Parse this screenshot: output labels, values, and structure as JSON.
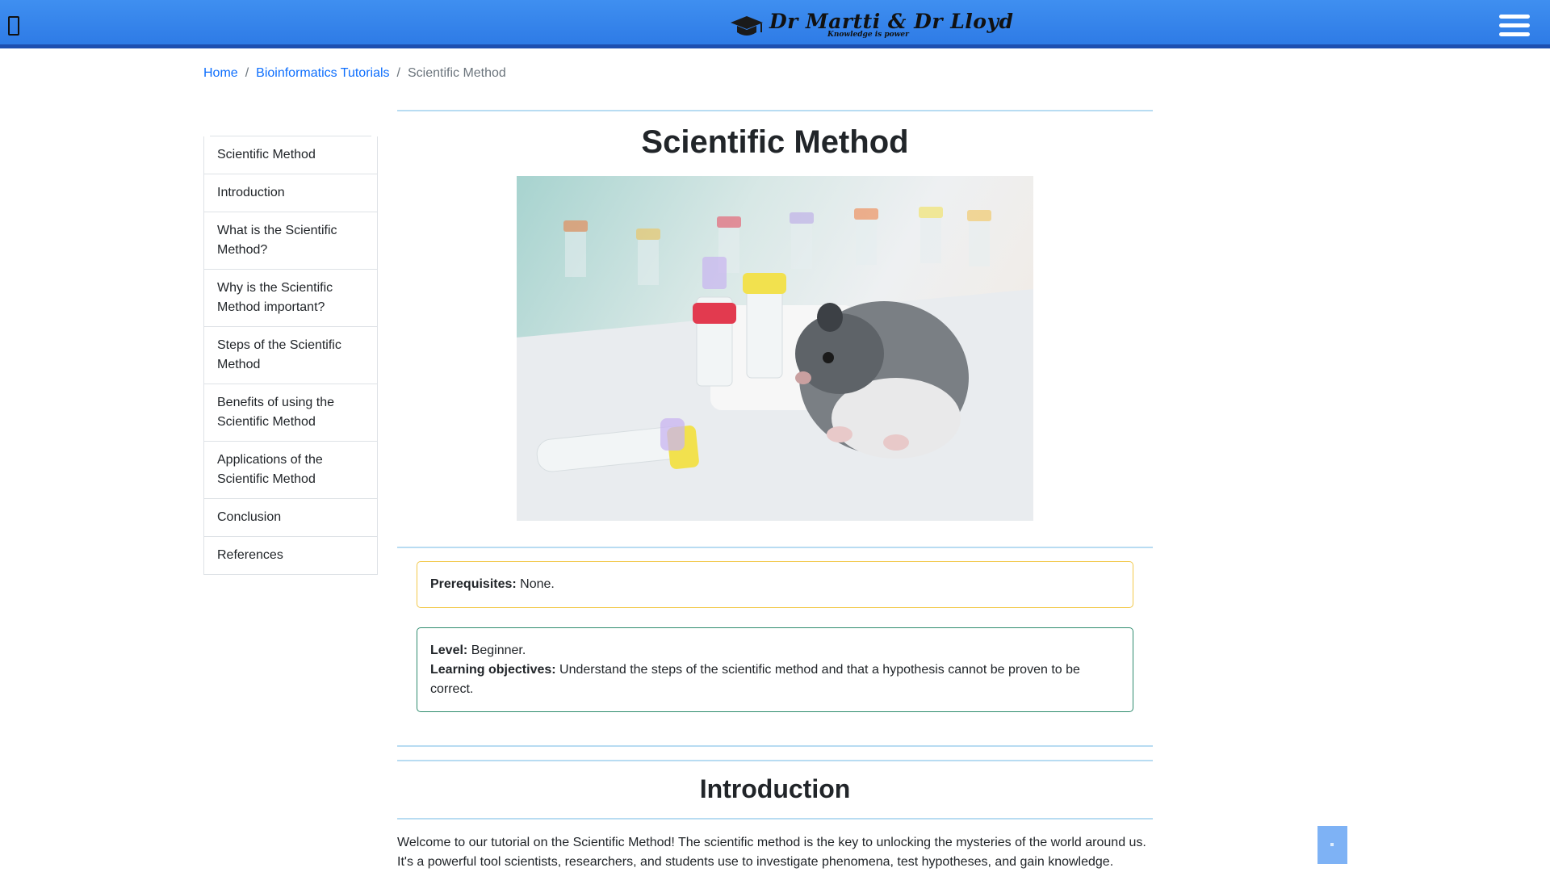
{
  "header": {
    "logo": {
      "title": "Dr Martti & Dr Lloyd",
      "tagline": "Knowledge is power"
    },
    "menu_icon": "hamburger-icon",
    "left_icon": "mobile-icon"
  },
  "breadcrumb": {
    "home": "Home",
    "section": "Bioinformatics Tutorials",
    "current": "Scientific Method",
    "separator": "/"
  },
  "sidebar": {
    "items": [
      {
        "label": "Scientific Method"
      },
      {
        "label": "Introduction"
      },
      {
        "label": "What is the Scientific Method?"
      },
      {
        "label": "Why is the Scientific Method important?"
      },
      {
        "label": "Steps of the Scientific Method"
      },
      {
        "label": "Benefits of using the Scientific Method"
      },
      {
        "label": "Applications of the Scientific Method"
      },
      {
        "label": "Conclusion"
      },
      {
        "label": "References"
      }
    ]
  },
  "main": {
    "title": "Scientific Method",
    "prerequisites": {
      "label": "Prerequisites:",
      "value": "None."
    },
    "level": {
      "label": "Level:",
      "value": "Beginner."
    },
    "objectives": {
      "label": "Learning objectives:",
      "value": "Understand the steps of the scientific method and that a hypothesis cannot be proven to be correct."
    },
    "intro_heading": "Introduction",
    "intro_text": "Welcome to our tutorial on the Scientific Method! The scientific method is the key to unlocking the mysteries of the world around us. It's a powerful tool scientists, researchers, and students use to investigate phenomena, test hypotheses, and gain knowledge."
  },
  "colors": {
    "header_blue": "#2e7be6",
    "link": "#0d6efd",
    "rule": "#b8dcf2",
    "callout_yellow": "#f2c94c",
    "callout_green": "#2f8c6e"
  }
}
